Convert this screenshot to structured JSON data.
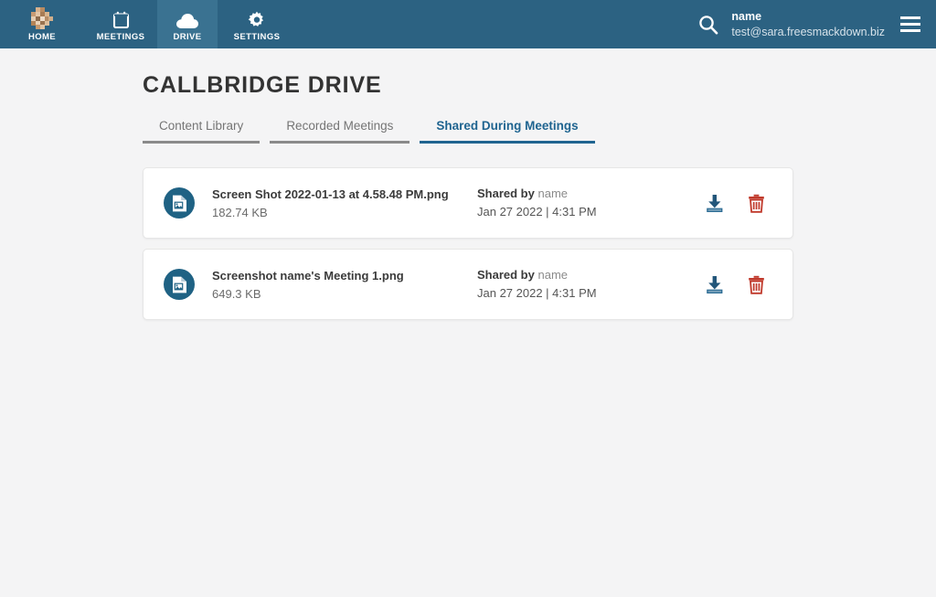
{
  "topbar": {
    "nav": [
      {
        "label": "HOME",
        "icon": "pixel-logo-icon",
        "active": false
      },
      {
        "label": "MEETINGS",
        "icon": "calendar-icon",
        "active": false
      },
      {
        "label": "DRIVE",
        "icon": "cloud-icon",
        "active": true
      },
      {
        "label": "SETTINGS",
        "icon": "gear-icon",
        "active": false
      }
    ],
    "search_icon": "search-icon",
    "menu_icon": "hamburger-menu-icon",
    "user": {
      "name": "name",
      "email": "test@sara.freesmackdown.biz"
    }
  },
  "page": {
    "title": "CALLBRIDGE DRIVE",
    "tabs": [
      {
        "label": "Content Library",
        "active": false
      },
      {
        "label": "Recorded Meetings",
        "active": false
      },
      {
        "label": "Shared During Meetings",
        "active": true
      }
    ]
  },
  "files": [
    {
      "icon": "image-file-icon",
      "name": "Screen Shot 2022-01-13 at 4.58.48 PM.png",
      "size": "182.74 KB",
      "shared_by_label": "Shared by",
      "shared_by_user": "name",
      "shared_date": "Jan 27 2022 | 4:31 PM",
      "download_icon": "download-icon",
      "delete_icon": "trash-icon"
    },
    {
      "icon": "image-file-icon",
      "name": "Screenshot name's Meeting 1.png",
      "size": "649.3 KB",
      "shared_by_label": "Shared by",
      "shared_by_user": "name",
      "shared_date": "Jan 27 2022 | 4:31 PM",
      "download_icon": "download-icon",
      "delete_icon": "trash-icon"
    }
  ],
  "colors": {
    "header_bg": "#2c6282",
    "header_active_bg": "#3a7291",
    "accent_blue": "#1f6490",
    "file_icon_bg": "#1f6284",
    "delete_red": "#c0392b",
    "page_bg": "#f4f4f5",
    "logo_tan": "#c9a27e"
  }
}
